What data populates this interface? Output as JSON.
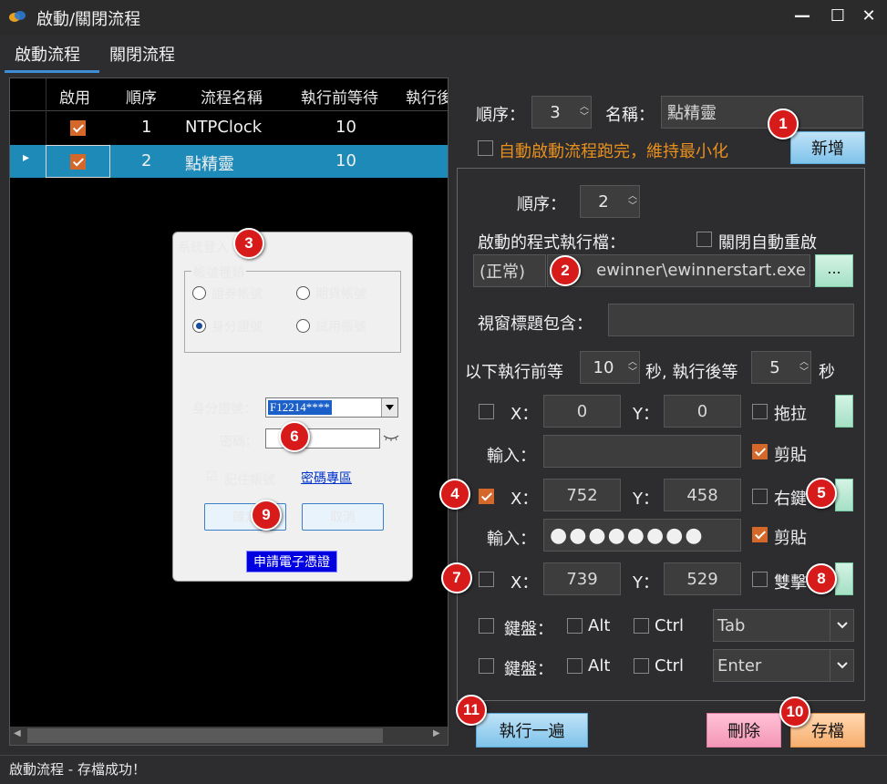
{
  "window": {
    "title": "啟動/關閉流程",
    "minimize": "—",
    "maximize": "☐",
    "close": "✕"
  },
  "tabs": [
    {
      "label": "啟動流程"
    },
    {
      "label": "關閉流程"
    }
  ],
  "grid": {
    "columns": [
      "啟用",
      "順序",
      "流程名稱",
      "執行前等待",
      "執行後"
    ],
    "rows": [
      {
        "enabled": true,
        "order": "1",
        "name": "NTPClock",
        "wait_before": "10"
      },
      {
        "enabled": true,
        "order": "2",
        "name": "點精靈",
        "wait_before": "10"
      }
    ],
    "selected_marker": "▸"
  },
  "top_form": {
    "order_label": "順序：",
    "order_value": "3",
    "name_label": "名稱：",
    "name_value": "點精靈",
    "auto_min_label": "自動啟動流程跑完，維持最小化",
    "add_button": "新增"
  },
  "step": {
    "order_label": "順序：",
    "order_value": "2",
    "exe_label": "啟動的程式執行檔：",
    "disable_restart_label": "關閉自動重啟",
    "mode_value": "(正常)",
    "exe_path": "ewinner\\ewinnerstart.exe",
    "browse_button": "...",
    "window_title_label": "視窗標題包含：",
    "window_title_value": "",
    "wait_before_label": "以下執行前等",
    "wait_before_value": "10",
    "wait_after_label": "秒, 執行後等",
    "wait_after_value": "5",
    "seconds_label": "秒",
    "x_label": "X：",
    "y_label": "Y：",
    "input_label": "輸入：",
    "paste_label": "剪貼",
    "actions": [
      {
        "checked": false,
        "x": "0",
        "y": "0",
        "mode": "拖拉",
        "mode_checked": false,
        "input": "",
        "paste": true
      },
      {
        "checked": true,
        "x": "752",
        "y": "458",
        "mode": "右鍵",
        "mode_checked": false,
        "input": "●●●●●●●●",
        "paste": true
      },
      {
        "checked": false,
        "x": "739",
        "y": "529",
        "mode": "雙擊",
        "mode_checked": false
      }
    ],
    "keyboard_label": "鍵盤：",
    "alt_label": "Alt",
    "ctrl_label": "Ctrl",
    "keys": [
      {
        "value": "Tab"
      },
      {
        "value": "Enter"
      }
    ]
  },
  "bottom_buttons": {
    "run_once": "執行一遍",
    "delete": "刪除",
    "save": "存檔"
  },
  "login_dialog": {
    "title": "系統登入",
    "group_label": "帳號種類",
    "radios": [
      {
        "label": "證券帳號",
        "selected": false
      },
      {
        "label": "期貨帳號",
        "selected": false
      },
      {
        "label": "身分證號",
        "selected": true
      },
      {
        "label": "試用帳號",
        "selected": false
      }
    ],
    "id_label": "身分證號：",
    "id_value": "F12214****",
    "password_label": "密碼：",
    "remember_label": "記住帳號",
    "remember_mark": "☑",
    "password_link": "密碼專區",
    "ok_button": "確定",
    "cancel_button": "取消",
    "cert_button": "申請電子憑證"
  },
  "badges": [
    "1",
    "2",
    "3",
    "4",
    "5",
    "6",
    "7",
    "8",
    "9",
    "10",
    "11"
  ],
  "status": {
    "text": "啟動流程 - 存檔成功！"
  },
  "colors": {
    "accent_orange": "#d4682a",
    "selection_blue": "#1d8ab8",
    "badge_red": "#d71b1b"
  }
}
